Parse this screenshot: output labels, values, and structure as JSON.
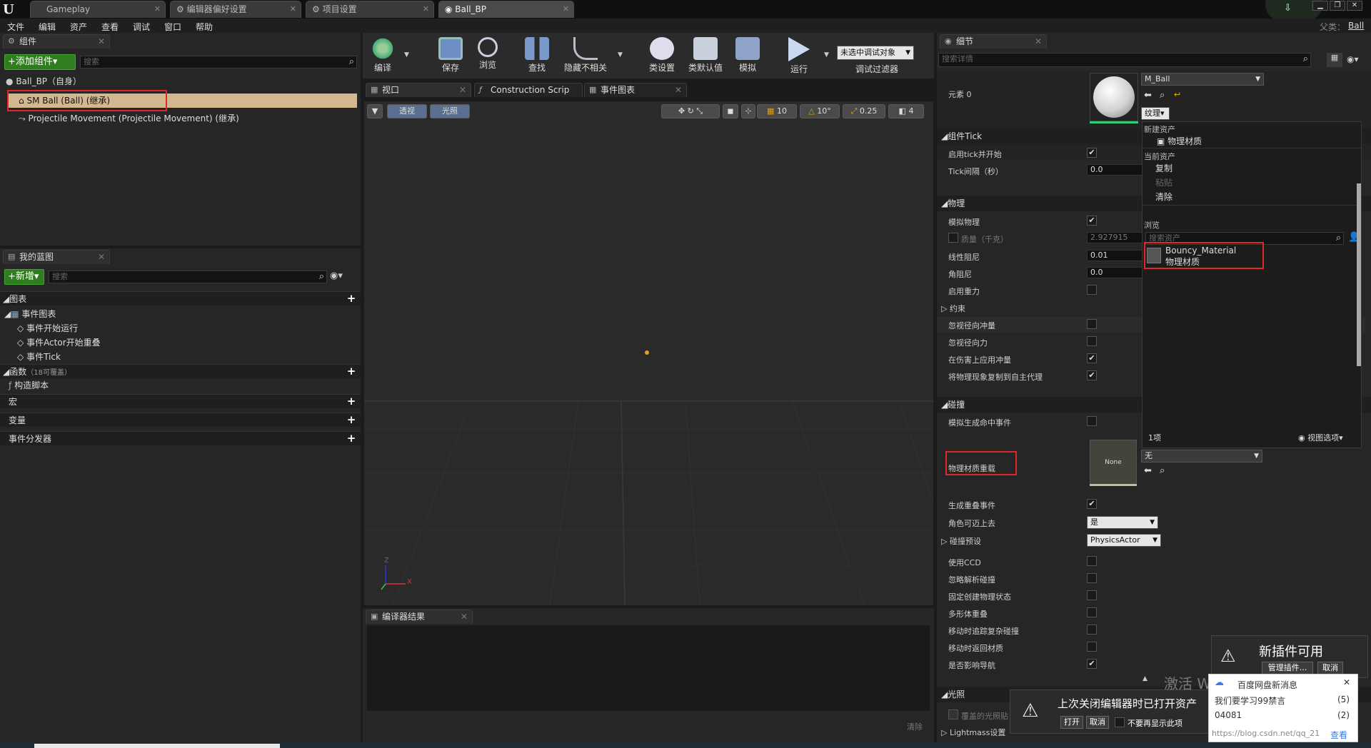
{
  "window": {
    "tabs": [
      "Gameplay",
      "编辑器偏好设置",
      "项目设置",
      "Ball_BP"
    ],
    "parent_label": "父类：",
    "parent_class": "Ball"
  },
  "menu": [
    "文件",
    "编辑",
    "资产",
    "查看",
    "调试",
    "窗口",
    "帮助"
  ],
  "components": {
    "tab": "组件",
    "add_button": "+添加组件▾",
    "search_placeholder": "搜索",
    "root": "Ball_BP（自身）",
    "items": [
      "SM Ball (Ball) (继承)",
      "Projectile Movement (Projectile Movement) (继承)"
    ]
  },
  "my_blueprint": {
    "tab": "我的蓝图",
    "new_button": "+新增▾",
    "search_placeholder": "搜索",
    "graphs_header": "图表",
    "event_graph": "事件图表",
    "events": [
      "事件开始运行",
      "事件Actor开始重叠",
      "事件Tick"
    ],
    "functions_header": "函数",
    "functions_note": "（18可覆盖）",
    "construction_script": "构造脚本",
    "macros": "宏",
    "variables": "变量",
    "dispatchers": "事件分发器"
  },
  "toolbar": {
    "buttons": [
      "编译",
      "保存",
      "浏览",
      "查找",
      "隐藏不相关",
      "类设置",
      "类默认值",
      "模拟",
      "运行"
    ],
    "debug_select": "未选中调试对象",
    "debug_filter": "调试过滤器"
  },
  "editor_tabs": [
    "视口",
    "Construction Scrip",
    "事件图表"
  ],
  "viewport": {
    "perspective": "透视",
    "lit": "光照",
    "grid_snap": "10",
    "rot_snap": "10°",
    "scale_snap": "0.25",
    "cam_speed": "4",
    "axis_x": "X",
    "axis_z": "Z"
  },
  "compiler": {
    "tab": "编译器结果",
    "clear": "清除"
  },
  "details": {
    "tab": "细节",
    "search_placeholder": "搜索详情",
    "element0": "元素 0",
    "material_name": "M_Ball",
    "texture_btn": "纹理▾",
    "sections": {
      "tick": "组件Tick",
      "physics": "物理",
      "collision": "碰撞",
      "lighting": "光照"
    },
    "tick_rows": [
      "启用tick并开始",
      "Tick间隔（秒）"
    ],
    "tick_interval": "0.0",
    "physics_rows": [
      "模拟物理",
      "质量（千克）",
      "线性阻尼",
      "角阻尼",
      "启用重力",
      "约束",
      "忽视径向冲量",
      "忽视径向力",
      "在伤害上应用冲量",
      "将物理现象复制到自主代理"
    ],
    "mass": "2.927915",
    "linear_damping": "0.01",
    "angular_damping": "0.0",
    "collision_rows": [
      "模拟生成命中事件",
      "物理材质重载",
      "生成重叠事件",
      "角色可迈上去",
      "碰撞预设",
      "使用CCD",
      "忽略解析碰撞",
      "固定创建物理状态",
      "多形体重叠",
      "移动时追踪复杂碰撞",
      "移动时返回材质",
      "是否影响导航"
    ],
    "phys_mat_value": "无",
    "none_thumb": "None",
    "step_up": "是",
    "preset": "PhysicsActor",
    "light_rows": [
      "覆盖的光照贴",
      "Lightmass设置"
    ]
  },
  "asset_popup": {
    "new_asset_hdr": "新建资产",
    "new_asset_item": "物理材质",
    "current_hdr": "当前资产",
    "copy": "复制",
    "paste": "粘贴",
    "clear": "清除",
    "browse_hdr": "浏览",
    "search_placeholder": "搜索资产",
    "asset_name": "Bouncy_Material",
    "asset_type": "物理材质",
    "count": "1项",
    "view_options": "视图选项▾"
  },
  "notifications": {
    "plugin_title": "新插件可用",
    "manage_plugins": "管理插件...",
    "cancel": "取消",
    "restore_msg": "上次关闭编辑器时已打开资产",
    "open": "打开",
    "cancel2": "取消",
    "dont_show": "不要再显示此项",
    "baidu_title": "百度网盘新消息",
    "baidu_rows": [
      {
        "text": "我们要学习99禁言",
        "count": "(5)"
      },
      {
        "text": "04081",
        "count": "(2)"
      }
    ],
    "baidu_view": "查看",
    "watermark1": "激活 Windows",
    "watermark2": "https://blog.csdn.net/qq_21"
  },
  "colors": {
    "accent_green": "#2f7d1f",
    "highlight_row": "#d3b88f",
    "annotation_red": "#e0282c"
  }
}
